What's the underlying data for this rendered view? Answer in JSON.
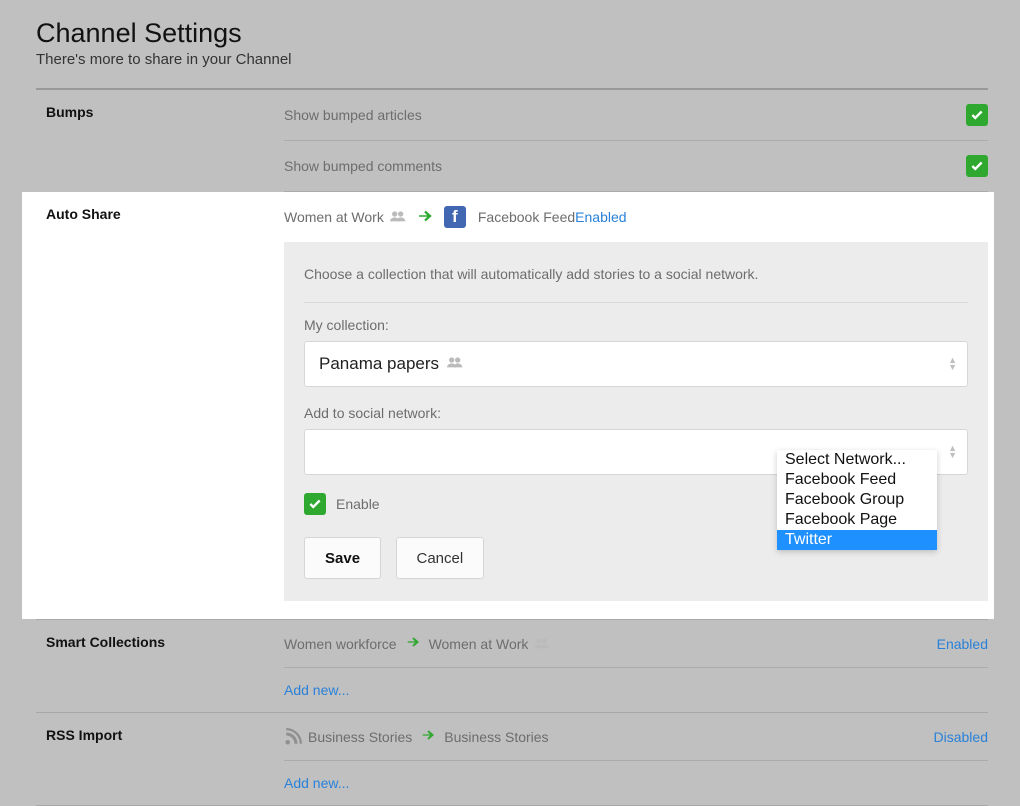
{
  "header": {
    "title": "Channel Settings",
    "subtitle": "There's more to share in your Channel"
  },
  "bumps": {
    "label": "Bumps",
    "row1": "Show bumped articles",
    "row2": "Show bumped comments"
  },
  "autoshare": {
    "label": "Auto Share",
    "source": "Women at Work",
    "destination": "Facebook Feed",
    "status": "Enabled",
    "panel": {
      "description": "Choose a collection that will automatically add stories to a social network.",
      "collection_label": "My collection:",
      "collection_value": "Panama papers",
      "network_label": "Add to social network:",
      "network_value": "",
      "enable_label": "Enable",
      "save": "Save",
      "cancel": "Cancel"
    },
    "dropdown": {
      "opt0": "Select Network...",
      "opt1": "Facebook Feed",
      "opt2": "Facebook Group",
      "opt3": "Facebook Page",
      "opt4": "Twitter"
    }
  },
  "smart": {
    "label": "Smart Collections",
    "source": "Women workforce",
    "destination": "Women at Work",
    "status": "Enabled",
    "addnew": "Add new..."
  },
  "rss": {
    "label": "RSS Import",
    "source": "Business Stories",
    "destination": "Business Stories",
    "status": "Disabled",
    "addnew": "Add new..."
  }
}
